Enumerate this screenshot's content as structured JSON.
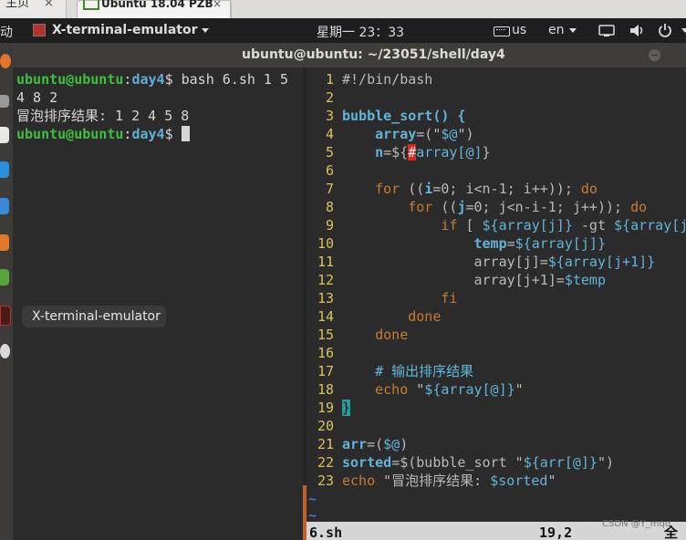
{
  "browser_tabs": {
    "home": "主页",
    "vm": "Ubuntu 18.04 PZB",
    "close_glyph": "×"
  },
  "topbar": {
    "left_fragment": "动",
    "app_name": "X-terminal-emulator",
    "clock": "星期一 23：33",
    "keyboard_layout": "us",
    "input_lang": "en"
  },
  "window": {
    "title": "ubuntu@ubuntu: ~/23051/shell/day4"
  },
  "shell": {
    "prompt_user": "ubuntu@ubuntu",
    "prompt_path": "day4",
    "prompt_symbol": "$",
    "command": "bash 6.sh 1 5",
    "output_1": "4 8 2",
    "output_2": "冒泡排序结果: 1 2 4 5 8"
  },
  "tooltip": "X-terminal-emulator",
  "vim": {
    "line_numbers": [
      "1",
      "2",
      "3",
      "4",
      "5",
      "6",
      "7",
      "8",
      "9",
      "10",
      "11",
      "12",
      "13",
      "14",
      "15",
      "16",
      "17",
      "18",
      "19",
      "20",
      "21",
      "22",
      "23"
    ],
    "tilde": "~",
    "statusline": {
      "filename": "6.sh",
      "position": "19,2",
      "mode_fragment": "全部"
    },
    "colors": {
      "keyword": "#c97c2c",
      "variable": "#62b4d9",
      "line_number": "#d8c35a"
    }
  },
  "watermark": "CSDN @Y_mqq"
}
